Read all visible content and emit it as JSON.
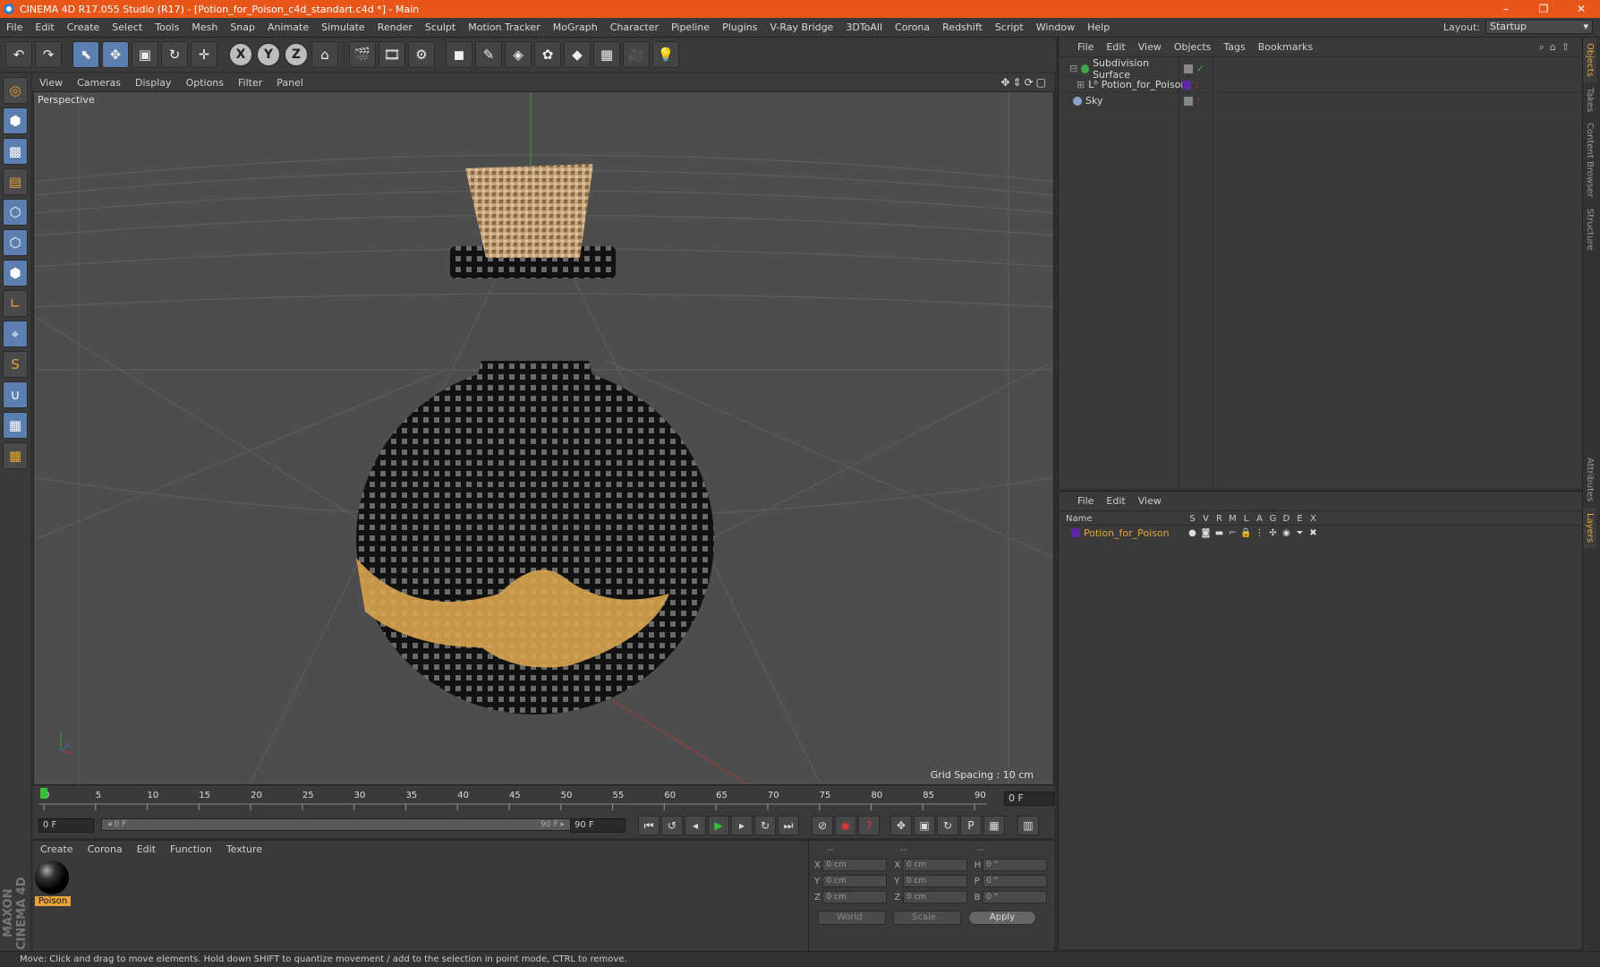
{
  "window": {
    "title": "CINEMA 4D R17.055 Studio (R17) - [Potion_for_Poison_c4d_standart.c4d *] - Main",
    "controls": [
      "–",
      "❐",
      "✕"
    ]
  },
  "menubar": {
    "items": [
      "File",
      "Edit",
      "Create",
      "Select",
      "Tools",
      "Mesh",
      "Snap",
      "Animate",
      "Simulate",
      "Render",
      "Sculpt",
      "Motion Tracker",
      "MoGraph",
      "Character",
      "Pipeline",
      "Plugins",
      "V-Ray Bridge",
      "3DToAll",
      "Corona",
      "Redshift",
      "Script",
      "Window",
      "Help"
    ],
    "layout_label": "Layout:",
    "layout_value": "Startup"
  },
  "viewport": {
    "menu": [
      "View",
      "Cameras",
      "Display",
      "Options",
      "Filter",
      "Panel"
    ],
    "camera_label": "Perspective",
    "grid_spacing": "Grid Spacing : 10 cm"
  },
  "timeline": {
    "ticks": [
      "0",
      "5",
      "10",
      "15",
      "20",
      "25",
      "30",
      "35",
      "40",
      "45",
      "50",
      "55",
      "60",
      "65",
      "70",
      "75",
      "80",
      "85",
      "90"
    ],
    "current_frame": "0 F"
  },
  "transport": {
    "start_field": "0 F",
    "slider_left": "◂ 0 F",
    "slider_right": "90 F ▸",
    "end_field": "90 F"
  },
  "material_panel": {
    "menu": [
      "Create",
      "Corona",
      "Edit",
      "Function",
      "Texture"
    ],
    "material_name": "Poison",
    "brand": "MAXON CINEMA 4D"
  },
  "coordinates": {
    "headers": [
      "--",
      "--",
      "--"
    ],
    "rows": [
      {
        "a": "X",
        "av": "0 cm",
        "b": "X",
        "bv": "0 cm",
        "c": "H",
        "cv": "0 °"
      },
      {
        "a": "Y",
        "av": "0 cm",
        "b": "Y",
        "bv": "0 cm",
        "c": "P",
        "cv": "0 °"
      },
      {
        "a": "Z",
        "av": "0 cm",
        "b": "Z",
        "bv": "0 cm",
        "c": "B",
        "cv": "0 °"
      }
    ],
    "world": "World",
    "scale": "Scale",
    "apply": "Apply"
  },
  "status": "Move: Click and drag to move elements. Hold down SHIFT to quantize movement / add to the selection in point mode, CTRL to remove.",
  "objects_panel": {
    "menu": [
      "File",
      "Edit",
      "View",
      "Objects",
      "Tags",
      "Bookmarks"
    ],
    "items": [
      {
        "name": "Subdivision Surface",
        "color": "#3ea84a"
      },
      {
        "name": "Potion_for_Poison",
        "color": "#bbbbbb"
      },
      {
        "name": "Sky",
        "color": "#8aa7c8"
      }
    ]
  },
  "layers_panel": {
    "menu": [
      "File",
      "Edit",
      "View"
    ],
    "name_header": "Name",
    "columns": [
      "S",
      "V",
      "R",
      "M",
      "L",
      "A",
      "G",
      "D",
      "E",
      "X"
    ],
    "layer": {
      "name": "Potion_for_Poison",
      "color": "#5b2aa0"
    }
  },
  "side_tabs": [
    "Objects",
    "Takes",
    "Content Browser",
    "Structure",
    "Attributes",
    "Layers"
  ]
}
